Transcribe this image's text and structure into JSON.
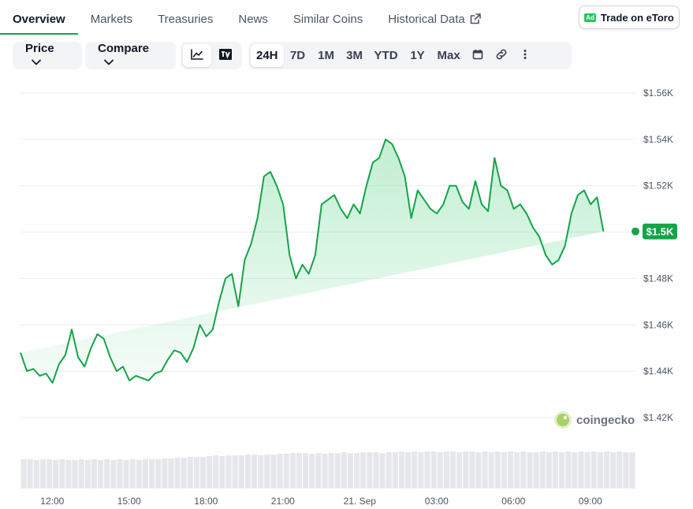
{
  "tabs": [
    {
      "label": "Overview",
      "active": true
    },
    {
      "label": "Markets"
    },
    {
      "label": "Treasuries"
    },
    {
      "label": "News"
    },
    {
      "label": "Similar Coins"
    },
    {
      "label": "Historical Data",
      "external": true
    }
  ],
  "ad_button": {
    "badge": "Ad",
    "label": "Trade on eToro"
  },
  "toolbar": {
    "price_label": "Price",
    "compare_label": "Compare",
    "chart_views": [
      {
        "icon": "line-chart-icon",
        "selected": true
      },
      {
        "icon": "tradingview-icon",
        "selected": false
      }
    ],
    "ranges": [
      "24H",
      "7D",
      "1M",
      "3M",
      "YTD",
      "1Y",
      "Max"
    ],
    "selected_range": "24H",
    "tools": [
      "calendar-icon",
      "link-icon",
      "more-vertical-icon"
    ]
  },
  "watermark": "coingecko",
  "colors": {
    "line": "#16a34a",
    "fill": "#22c55e",
    "badge": "#16a34a",
    "grid": "#eceef1",
    "volume": "#e5e7eb"
  },
  "chart_data": {
    "type": "area",
    "y_ticks": [
      "$1.56K",
      "$1.54K",
      "$1.52K",
      "$1.5K",
      "$1.48K",
      "$1.46K",
      "$1.44K",
      "$1.42K"
    ],
    "y_tick_values": [
      1560,
      1540,
      1520,
      1500,
      1480,
      1460,
      1440,
      1420
    ],
    "ylim": [
      1420,
      1560
    ],
    "x_ticks": [
      "12:00",
      "15:00",
      "18:00",
      "21:00",
      "21. Sep",
      "03:00",
      "06:00",
      "09:00"
    ],
    "x_tick_hours": [
      1.24,
      4.24,
      7.24,
      10.24,
      13.24,
      16.24,
      19.24,
      22.24
    ],
    "xlim_hours": [
      0,
      24
    ],
    "current_price_label": "$1.5K",
    "current_price": 1500.3,
    "hours": [
      0,
      0.25,
      0.5,
      0.75,
      1,
      1.25,
      1.5,
      1.75,
      2,
      2.25,
      2.5,
      2.75,
      3,
      3.25,
      3.5,
      3.75,
      4,
      4.25,
      4.5,
      4.75,
      5,
      5.25,
      5.5,
      5.75,
      6,
      6.25,
      6.5,
      6.75,
      7,
      7.25,
      7.5,
      7.75,
      8,
      8.25,
      8.5,
      8.75,
      9,
      9.25,
      9.5,
      9.75,
      10,
      10.25,
      10.5,
      10.75,
      11,
      11.25,
      11.5,
      11.75,
      12,
      12.25,
      12.5,
      12.75,
      13,
      13.25,
      13.5,
      13.75,
      14,
      14.25,
      14.5,
      14.75,
      15,
      15.25,
      15.5,
      15.75,
      16,
      16.25,
      16.5,
      16.75,
      17,
      17.25,
      17.5,
      17.75,
      18,
      18.25,
      18.5,
      18.75,
      19,
      19.25,
      19.5,
      19.75,
      20,
      20.25,
      20.5,
      20.75,
      21,
      21.25,
      21.5,
      21.75,
      22,
      22.25,
      22.5,
      22.75,
      23,
      23.25,
      23.5,
      23.75,
      24
    ],
    "prices": [
      1448,
      1440,
      1441,
      1438,
      1439,
      1435,
      1443,
      1447,
      1458,
      1446,
      1442,
      1450,
      1456,
      1454,
      1446,
      1440,
      1442,
      1436,
      1438,
      1437,
      1436,
      1439,
      1440,
      1445,
      1449,
      1448,
      1444,
      1450,
      1460,
      1455,
      1458,
      1470,
      1480,
      1482,
      1468,
      1488,
      1495,
      1506,
      1524,
      1526,
      1520,
      1512,
      1490,
      1480,
      1486,
      1482,
      1490,
      1512,
      1514,
      1516,
      1510,
      1506,
      1512,
      1508,
      1520,
      1530,
      1532,
      1540,
      1538,
      1532,
      1524,
      1506,
      1518,
      1514,
      1510,
      1508,
      1512,
      1520,
      1520,
      1513,
      1510,
      1522,
      1512,
      1509,
      1532,
      1520,
      1518,
      1510,
      1512,
      1508,
      1502,
      1498,
      1490,
      1486,
      1488,
      1494,
      1508,
      1516,
      1518,
      1512,
      1515,
      1500.3
    ],
    "volume": [
      38,
      38,
      37,
      38,
      38,
      37,
      38,
      37,
      37,
      38,
      37,
      38,
      37,
      38,
      37,
      38,
      37,
      38,
      37,
      38,
      38,
      38,
      39,
      39,
      40,
      40,
      41,
      41,
      41,
      42,
      43,
      42,
      43,
      43,
      43,
      44,
      44,
      43,
      44,
      44,
      45,
      45,
      46,
      46,
      46,
      45,
      46,
      45,
      46,
      46,
      47,
      46,
      46,
      47,
      47,
      47,
      46,
      47,
      47,
      48,
      47,
      48,
      47,
      48,
      48,
      47,
      48,
      48,
      47,
      48,
      48,
      47,
      48,
      47,
      48,
      47,
      48,
      47,
      48,
      47,
      47,
      48,
      47,
      48,
      47,
      48,
      47,
      48,
      47,
      48,
      47,
      48,
      47,
      48,
      47,
      47
    ]
  }
}
